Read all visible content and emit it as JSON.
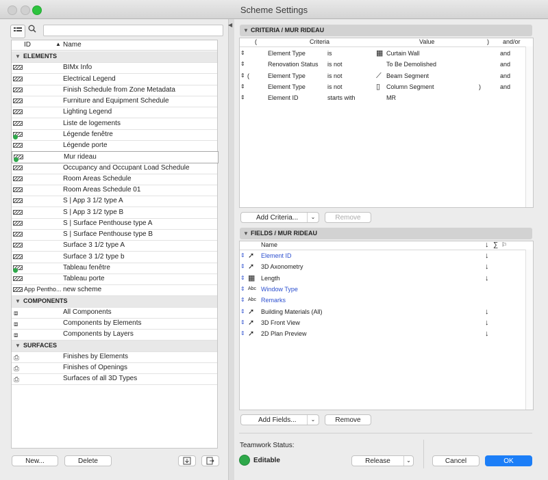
{
  "window": {
    "title": "Scheme Settings"
  },
  "left": {
    "columns": {
      "id": "ID",
      "name": "Name"
    },
    "rows": [
      {
        "kind": "section",
        "name": "ELEMENTS"
      },
      {
        "kind": "item",
        "icon": "hatch-icon",
        "id": "",
        "name": "BIMx Info"
      },
      {
        "kind": "item",
        "icon": "hatch-icon",
        "id": "",
        "name": "Electrical Legend"
      },
      {
        "kind": "item",
        "icon": "hatch-icon",
        "id": "",
        "name": "Finish Schedule from Zone Metadata"
      },
      {
        "kind": "item",
        "icon": "hatch-icon",
        "id": "",
        "name": "Furniture and Equipment Schedule"
      },
      {
        "kind": "item",
        "icon": "hatch-icon",
        "id": "",
        "name": "Lighting Legend"
      },
      {
        "kind": "item",
        "icon": "hatch-icon",
        "id": "",
        "name": "Liste de logements"
      },
      {
        "kind": "item",
        "icon": "hatch-icon",
        "id": "",
        "name": "Légende fenêtre",
        "dot": true
      },
      {
        "kind": "item",
        "icon": "hatch-icon",
        "id": "",
        "name": "Légende porte"
      },
      {
        "kind": "item",
        "icon": "hatch-icon",
        "id": "",
        "name": "Mur rideau",
        "dot": true,
        "selected": true
      },
      {
        "kind": "item",
        "icon": "hatch-icon",
        "id": "",
        "name": "Occupancy and Occupant Load Schedule"
      },
      {
        "kind": "item",
        "icon": "hatch-icon",
        "id": "",
        "name": "Room Areas Schedule"
      },
      {
        "kind": "item",
        "icon": "hatch-icon",
        "id": "",
        "name": "Room Areas Schedule 01"
      },
      {
        "kind": "item",
        "icon": "hatch-icon",
        "id": "",
        "name": "S | App 3 1/2 type A"
      },
      {
        "kind": "item",
        "icon": "hatch-icon",
        "id": "",
        "name": "S | App 3 1/2 type B"
      },
      {
        "kind": "item",
        "icon": "hatch-icon",
        "id": "",
        "name": "S | Surface Penthouse type A"
      },
      {
        "kind": "item",
        "icon": "hatch-icon",
        "id": "",
        "name": "S | Surface Penthouse type B"
      },
      {
        "kind": "item",
        "icon": "hatch-icon",
        "id": "",
        "name": "Surface 3 1/2 type A"
      },
      {
        "kind": "item",
        "icon": "hatch-icon",
        "id": "",
        "name": "Surface 3 1/2 type b"
      },
      {
        "kind": "item",
        "icon": "hatch-icon",
        "id": "",
        "name": "Tableau fenêtre",
        "dot": true
      },
      {
        "kind": "item",
        "icon": "hatch-icon",
        "id": "",
        "name": "Tableau porte"
      },
      {
        "kind": "item",
        "icon": "hatch-icon",
        "id": "App Pentho...",
        "name": "new scheme"
      },
      {
        "kind": "section",
        "name": "COMPONENTS"
      },
      {
        "kind": "item",
        "icon": "components-icon",
        "id": "",
        "name": "All Components"
      },
      {
        "kind": "item",
        "icon": "components-icon",
        "id": "",
        "name": "Components by Elements"
      },
      {
        "kind": "item",
        "icon": "components-icon",
        "id": "",
        "name": "Components by Layers"
      },
      {
        "kind": "section",
        "name": "SURFACES"
      },
      {
        "kind": "item",
        "icon": "brush-icon",
        "id": "",
        "name": "Finishes by Elements"
      },
      {
        "kind": "item",
        "icon": "brush-icon",
        "id": "",
        "name": "Finishes of Openings"
      },
      {
        "kind": "item",
        "icon": "brush-icon",
        "id": "",
        "name": "Surfaces of all 3D Types"
      }
    ],
    "buttons": {
      "new": "New...",
      "delete": "Delete"
    }
  },
  "criteria": {
    "header": "CRITERIA / MUR RIDEAU",
    "columns": {
      "open": "(",
      "criteria": "Criteria",
      "value": "Value",
      "close": ")",
      "andor": "and/or"
    },
    "rows": [
      {
        "open": "",
        "element": "Element Type",
        "op": "is",
        "icon": "curtain-wall-icon",
        "value": "Curtain Wall",
        "close": "",
        "andor": "and"
      },
      {
        "open": "",
        "element": "Renovation Status",
        "op": "is not",
        "icon": "",
        "value": "To Be Demolished",
        "close": "",
        "andor": "and"
      },
      {
        "open": "(",
        "element": "Element Type",
        "op": "is not",
        "icon": "beam-icon",
        "value": "Beam Segment",
        "close": "",
        "andor": "and"
      },
      {
        "open": "",
        "element": "Element Type",
        "op": "is not",
        "icon": "column-icon",
        "value": "Column Segment",
        "close": ")",
        "andor": "and"
      },
      {
        "open": "",
        "element": "Element ID",
        "op": "starts with",
        "icon": "",
        "value": "MR",
        "close": "",
        "andor": ""
      }
    ],
    "buttons": {
      "add": "Add Criteria...",
      "remove": "Remove"
    }
  },
  "fields": {
    "header": "FIELDS / MUR RIDEAU",
    "columns": {
      "name": "Name"
    },
    "rows": [
      {
        "icon": "pointer-icon",
        "name": "Element ID",
        "blue": true,
        "sort": true
      },
      {
        "icon": "pointer-icon",
        "name": "3D Axonometry",
        "blue": false,
        "sort": true
      },
      {
        "icon": "grid-icon",
        "name": "Length",
        "blue": false,
        "sort": true
      },
      {
        "icon": "abc-icon",
        "name": "Window Type",
        "blue": true,
        "sort": false
      },
      {
        "icon": "abc-icon",
        "name": "Remarks",
        "blue": true,
        "sort": false
      },
      {
        "icon": "pointer-icon",
        "name": "Building Materials (All)",
        "blue": false,
        "sort": true
      },
      {
        "icon": "pointer-icon",
        "name": "3D Front View",
        "blue": false,
        "sort": true
      },
      {
        "icon": "pointer-icon",
        "name": "2D Plan Preview",
        "blue": false,
        "sort": true
      }
    ],
    "buttons": {
      "add": "Add Fields...",
      "remove": "Remove"
    }
  },
  "teamwork": {
    "label": "Teamwork Status:",
    "status": "Editable",
    "release": "Release"
  },
  "dialog": {
    "cancel": "Cancel",
    "ok": "OK"
  },
  "colors": {
    "accent": "#1c7ef7",
    "status_green": "#2ea84a",
    "link_blue": "#2c4fcf"
  }
}
